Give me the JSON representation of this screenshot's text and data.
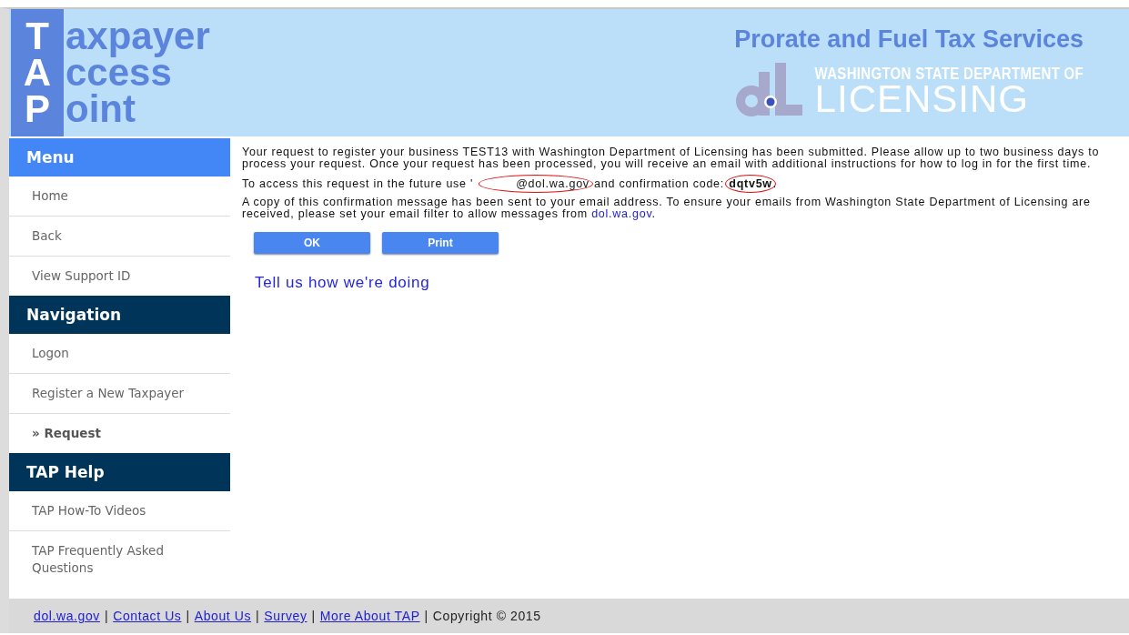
{
  "header": {
    "logo_letters": [
      "T",
      "A",
      "P"
    ],
    "logo_words": [
      "axpayer",
      "ccess",
      "oint"
    ],
    "service_title": "Prorate and Fuel Tax Services",
    "agency_line_1": "WASHINGTON STATE DEPARTMENT OF",
    "agency_line_2": "LICENSING"
  },
  "sidebar": {
    "sections": [
      {
        "title": "Menu",
        "kind": "primary",
        "items": [
          {
            "label": "Home",
            "selected": false
          },
          {
            "label": "Back",
            "selected": false
          },
          {
            "label": "View Support ID",
            "selected": false
          }
        ]
      },
      {
        "title": "Navigation",
        "kind": "dark",
        "items": [
          {
            "label": "Logon",
            "selected": false
          },
          {
            "label": "Register a New Taxpayer",
            "selected": false
          },
          {
            "label": "» Request",
            "selected": true
          }
        ]
      },
      {
        "title": "TAP Help",
        "kind": "dark",
        "items": [
          {
            "label": "TAP How-To Videos",
            "selected": false
          },
          {
            "label": "TAP Frequently Asked Questions",
            "selected": false
          }
        ]
      }
    ]
  },
  "message": {
    "paragraph_1": "Your request to register your business TEST13 with Washington Department of Licensing has been submitted. Please allow up to two business days to process your request. Once your request has been processed, you will receive an email with additional instructions for how to log in for the first time.",
    "paragraph_2": {
      "prefix": "To access this request in the future use '",
      "email": "@dol.wa.gov",
      "middle": " and confirmation code: ",
      "code": "dqtv5w",
      "suffix": ".",
      "circled": true
    },
    "paragraph_3": "A copy of this confirmation message has been sent to your email address. To ensure your emails from Washington State Department of Licensing are received, please set your email filter to allow messages from ",
    "paragraph_3_link": "dol.wa.gov",
    "paragraph_3_end": "."
  },
  "buttons": [
    "OK",
    "Print"
  ],
  "feedback_link": "Tell us how we're doing",
  "footer": {
    "links": [
      "dol.wa.gov",
      "Contact Us",
      "About Us",
      "Survey",
      "More About TAP"
    ],
    "separator": "|",
    "copyright": "Copyright © 2015"
  }
}
